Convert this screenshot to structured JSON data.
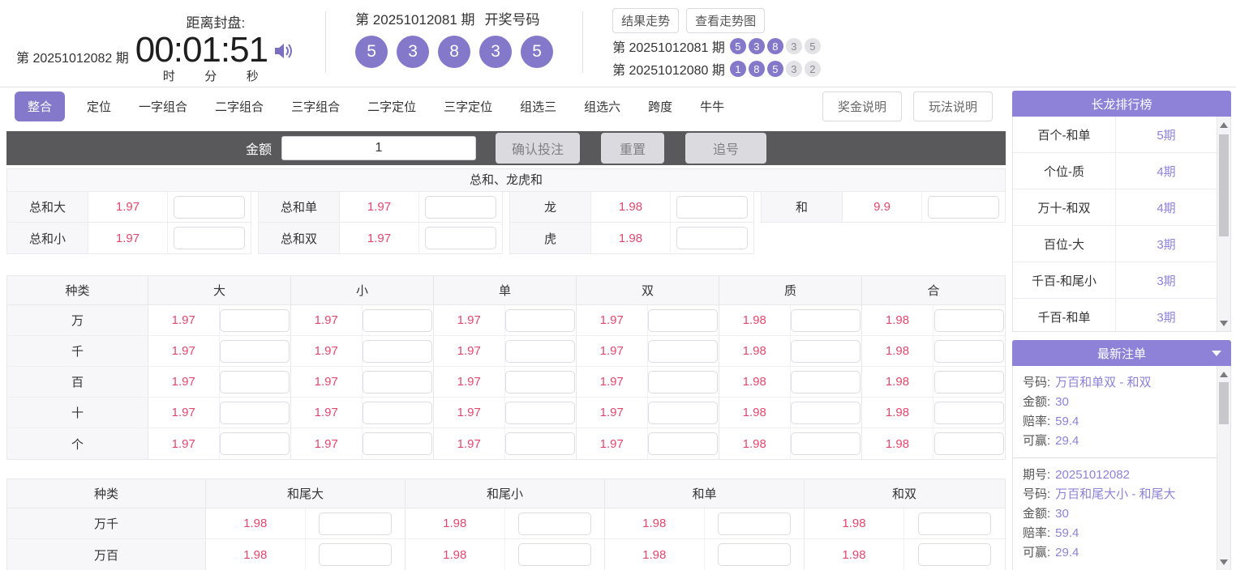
{
  "colors": {
    "accent": "#8478cb",
    "odds_red": "#e2486e",
    "panel_purple": "#8d82d7",
    "toolbar_dark": "#59595b"
  },
  "header": {
    "current_period": "第 20251012082 期",
    "countdown": {
      "title": "距离封盘:",
      "time": "00:01:51",
      "units": [
        "时",
        "分",
        "秒"
      ]
    },
    "draw": {
      "period_label": "第 20251012081 期",
      "title": "开奖号码",
      "balls": [
        "5",
        "3",
        "8",
        "3",
        "5"
      ]
    },
    "trend": {
      "buttons": [
        "结果走势",
        "查看走势图"
      ],
      "history": [
        {
          "label": "第 20251012081 期",
          "balls": [
            {
              "n": "5",
              "hot": true
            },
            {
              "n": "3",
              "hot": true
            },
            {
              "n": "8",
              "hot": true
            },
            {
              "n": "3",
              "hot": false
            },
            {
              "n": "5",
              "hot": false
            }
          ]
        },
        {
          "label": "第 20251012080 期",
          "balls": [
            {
              "n": "1",
              "hot": true
            },
            {
              "n": "8",
              "hot": true
            },
            {
              "n": "5",
              "hot": true
            },
            {
              "n": "3",
              "hot": false
            },
            {
              "n": "2",
              "hot": false
            }
          ]
        }
      ]
    }
  },
  "tabs": {
    "items": [
      {
        "label": "整合",
        "active": true
      },
      {
        "label": "定位",
        "active": false
      },
      {
        "label": "一字组合",
        "active": false
      },
      {
        "label": "二字组合",
        "active": false
      },
      {
        "label": "三字组合",
        "active": false
      },
      {
        "label": "二字定位",
        "active": false
      },
      {
        "label": "三字定位",
        "active": false
      },
      {
        "label": "组选三",
        "active": false
      },
      {
        "label": "组选六",
        "active": false
      },
      {
        "label": "跨度",
        "active": false
      },
      {
        "label": "牛牛",
        "active": false
      }
    ],
    "info_buttons": [
      "奖金说明",
      "玩法说明"
    ]
  },
  "toolbar": {
    "amount_label": "金额",
    "amount_value": "1",
    "buttons": [
      "确认投注",
      "重置",
      "追号"
    ]
  },
  "sum_section": {
    "title": "总和、龙虎和",
    "rows": [
      [
        {
          "label": "总和大",
          "odds": "1.97"
        },
        {
          "label": "总和单",
          "odds": "1.97"
        },
        {
          "label": "龙",
          "odds": "1.98"
        },
        {
          "label": "和",
          "odds": "9.9"
        }
      ],
      [
        {
          "label": "总和小",
          "odds": "1.97"
        },
        {
          "label": "总和双",
          "odds": "1.97"
        },
        {
          "label": "虎",
          "odds": "1.98"
        },
        null
      ]
    ]
  },
  "position_table": {
    "headers": [
      "种类",
      "大",
      "小",
      "单",
      "双",
      "质",
      "合"
    ],
    "rows": [
      {
        "label": "万",
        "odds": [
          "1.97",
          "1.97",
          "1.97",
          "1.97",
          "1.98",
          "1.98"
        ]
      },
      {
        "label": "千",
        "odds": [
          "1.97",
          "1.97",
          "1.97",
          "1.97",
          "1.98",
          "1.98"
        ]
      },
      {
        "label": "百",
        "odds": [
          "1.97",
          "1.97",
          "1.97",
          "1.97",
          "1.98",
          "1.98"
        ]
      },
      {
        "label": "十",
        "odds": [
          "1.97",
          "1.97",
          "1.97",
          "1.97",
          "1.98",
          "1.98"
        ]
      },
      {
        "label": "个",
        "odds": [
          "1.97",
          "1.97",
          "1.97",
          "1.97",
          "1.98",
          "1.98"
        ]
      }
    ]
  },
  "sum_tail_table": {
    "headers": [
      "种类",
      "和尾大",
      "和尾小",
      "和单",
      "和双"
    ],
    "rows": [
      {
        "label": "万千",
        "odds": [
          "1.98",
          "1.98",
          "1.98",
          "1.98"
        ]
      },
      {
        "label": "万百",
        "odds": [
          "1.98",
          "1.98",
          "1.98",
          "1.98"
        ]
      }
    ]
  },
  "sidebar": {
    "streak_panel": {
      "title": "长龙排行榜",
      "rows": [
        {
          "label": "百个-和单",
          "value": "5期"
        },
        {
          "label": "个位-质",
          "value": "4期"
        },
        {
          "label": "万十-和双",
          "value": "4期"
        },
        {
          "label": "百位-大",
          "value": "3期"
        },
        {
          "label": "千百-和尾小",
          "value": "3期"
        },
        {
          "label": "千百-和单",
          "value": "3期"
        }
      ]
    },
    "orders_panel": {
      "title": "最新注单",
      "orders": [
        {
          "lines": [
            {
              "label": "号码:",
              "value": "万百和单双 - 和双"
            },
            {
              "label": "金额:",
              "value": "30"
            },
            {
              "label": "赔率:",
              "value": "59.4"
            },
            {
              "label": "可赢:",
              "value": "29.4"
            }
          ]
        },
        {
          "lines": [
            {
              "label": "期号:",
              "value": "20251012082"
            },
            {
              "label": "号码:",
              "value": "万百和尾大小 - 和尾大"
            },
            {
              "label": "金额:",
              "value": "30"
            },
            {
              "label": "赔率:",
              "value": "59.4"
            },
            {
              "label": "可赢:",
              "value": "29.4"
            }
          ]
        }
      ]
    }
  }
}
